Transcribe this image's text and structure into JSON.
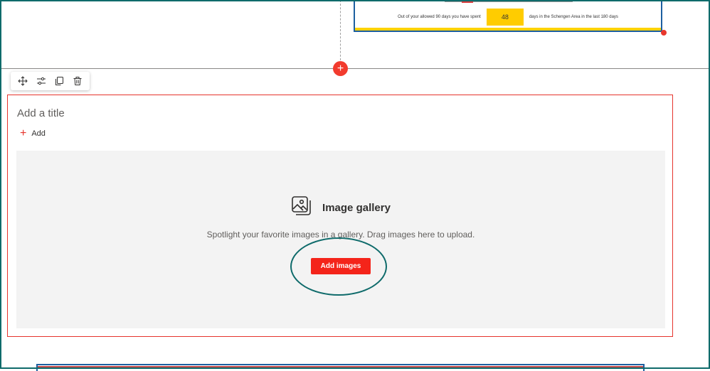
{
  "top_section": {
    "schengen_card": {
      "text_before": "Out of your allowed 90 days you have spent",
      "days_value": "48",
      "text_after": "days in the Schengen Area in the last 180 days",
      "colors": {
        "border": "#1d5fa0",
        "days_box": "#ffcc00",
        "bottom_bar": "#ffd200"
      }
    },
    "add_section_label": "+"
  },
  "toolbar": {
    "icons": [
      "move-icon",
      "edit-properties-icon",
      "duplicate-icon",
      "delete-icon"
    ]
  },
  "webpart": {
    "title_placeholder": "Add a title",
    "add_label": "Add",
    "add_icon": "+",
    "gallery": {
      "icon": "image-gallery-icon",
      "title": "Image gallery",
      "description": "Spotlight your favorite images in a gallery. Drag images here to upload.",
      "button_label": "Add images"
    }
  },
  "colors": {
    "accent": "#f4241a",
    "frame": "#0f6b6b",
    "selection_border": "#e6342c",
    "placeholder_bg": "#f3f3f3"
  }
}
